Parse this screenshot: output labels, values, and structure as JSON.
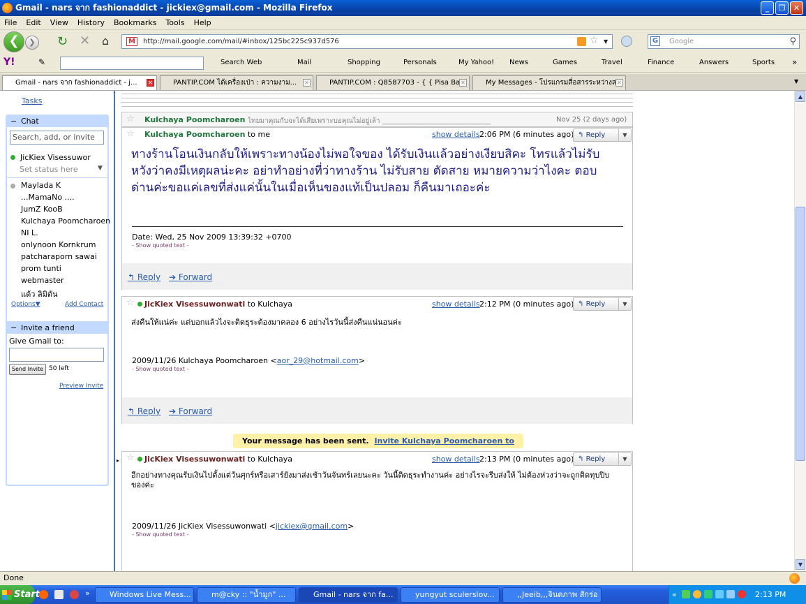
{
  "window": {
    "title": "Gmail - nars จาก fashionaddict - jickiex@gmail.com - Mozilla Firefox"
  },
  "menu": [
    "File",
    "Edit",
    "View",
    "History",
    "Bookmarks",
    "Tools",
    "Help"
  ],
  "nav": {
    "url": "http://mail.google.com/mail/#inbox/125bc225c937d576",
    "search_placeholder": "Google",
    "search_engine_label": "G"
  },
  "yahoo_toolbar": {
    "logo": "Y!",
    "search_web": "Search Web",
    "items": [
      "Mail",
      "Shopping",
      "Personals",
      "My Yahoo!",
      "News",
      "Games",
      "Travel",
      "Finance",
      "Answers",
      "Sports"
    ],
    "more": "»"
  },
  "tabs": [
    {
      "label": "Gmail - nars จาก fashionaddict - j...",
      "active": true
    },
    {
      "label": "PANTIP.COM ได้เครื่องเป่า : ความงาม...",
      "active": false
    },
    {
      "label": "PANTIP.COM : Q8587703 - { { Pisa Ba...",
      "active": false
    },
    {
      "label": "My Messages - โปรแกรมสื่อสารระหว่างส...",
      "active": false
    }
  ],
  "sidebar": {
    "tasks": "Tasks",
    "chat_header": "Chat",
    "chat_search_placeholder": "Search, add, or invite",
    "me": "JicKiex Visessuwor",
    "status": "Set status here",
    "contacts": [
      "Maylada K",
      "...MamaNo ....",
      "JumZ KooB",
      "Kulchaya Poomcharoen",
      "NI L.",
      "onlynoon Kornkrum",
      "patcharaporn sawai",
      "prom tunti",
      "webmaster",
      "แต้ว ลิมิตัน"
    ],
    "options": "Options",
    "add_contact": "Add Contact",
    "invite_header": "Invite a friend",
    "give_gmail": "Give Gmail to:",
    "send_invite": "Send Invite",
    "invites_left": "50 left",
    "preview_invite": "Preview Invite"
  },
  "collapsed": {
    "sender": "Kulchaya Poomcharoen",
    "snippet": "ไทยมาคุณกับจะได้เสียเพราะบอคุณไม่อยู่เล้า _______________________________",
    "date": "Nov 25 (2 days ago)"
  },
  "messages": [
    {
      "sender": "Kulchaya Poomcharoen",
      "to": "to me",
      "show_details": "show details",
      "time": "2:06 PM (6 minutes ago)",
      "body": "ทางร้านโอนเงินกลับให้เพราะทางน้องไม่พอใจของ ได้รับเงินแล้วอย่างเงียบสิคะ โทรแล้วไม่รับหวังว่าคงมีเหตุผลน่ะคะ อย่าทำอย่างที่ว่าทางร้าน ไม่รับสาย ตัดสาย หมายความว่าไงคะ ตอบด่านค่ะขอแค่เลขที่ส่งแค่นั้นในเมื่อเห็นของแท้เป็นปลอม ก็คืนมาเถอะค่ะ",
      "date_line": "Date: Wed, 25 Nov 2009 13:39:32 +0700",
      "show_quoted": "- Show quoted text -",
      "reply": "Reply",
      "forward": "Forward"
    },
    {
      "sender": "JicKiex Visessuwonwati",
      "to": "to Kulchaya",
      "show_details": "show details",
      "time": "2:12 PM (0 minutes ago)",
      "body": "ส่งคืนให้แน่ค่ะ แต่บอกแล้วไงจะติดธุระต้องมาคลอง 6 อย่างไรวันนี้ส่งคืนแน่นอนค่ะ",
      "quote_prefix": "2009/11/26 Kulchaya Poomcharoen <",
      "quote_email": "aor_29@hotmail.com",
      "quote_suffix": ">",
      "show_quoted": "- Show quoted text -",
      "reply": "Reply",
      "forward": "Forward"
    },
    {
      "sender": "JicKiex Visessuwonwati",
      "to": "to Kulchaya",
      "show_details": "show details",
      "time": "2:13 PM (0 minutes ago)",
      "body": "อีกอย่างทางคุณรับเงินไปตั้งแต่วันศุกร์หรือเสาร์ยังมาส่งเช้าวันจันทร์เลยนะคะ วันนี้ติดธุระทำงานค่ะ อย่างไรจะรีบส่งให้ ไม่ต้องห่วงว่าจะถูกติดทุบปิบของค่ะ",
      "quote_prefix": "2009/11/26 JicKiex Visessuwonwati <",
      "quote_email": "jickiex@gmail.com",
      "quote_suffix": ">",
      "show_quoted": "- Show quoted text -"
    }
  ],
  "reply_label": "Reply",
  "sent_notice": {
    "text": "Your message has been sent.",
    "link": "Invite Kulchaya Poomcharoen to Gmail"
  },
  "statusbar": {
    "text": "Done"
  },
  "taskbar": {
    "start": "Start",
    "items": [
      "Windows Live Mess...",
      "m@cky :: \"น้ำมูก\" ...",
      "Gmail - nars จาก fa...",
      "yungyut sculerslov...",
      ",,Jeeib,,,จินตภาพ สักร่อ"
    ],
    "clock": "2:13 PM"
  }
}
